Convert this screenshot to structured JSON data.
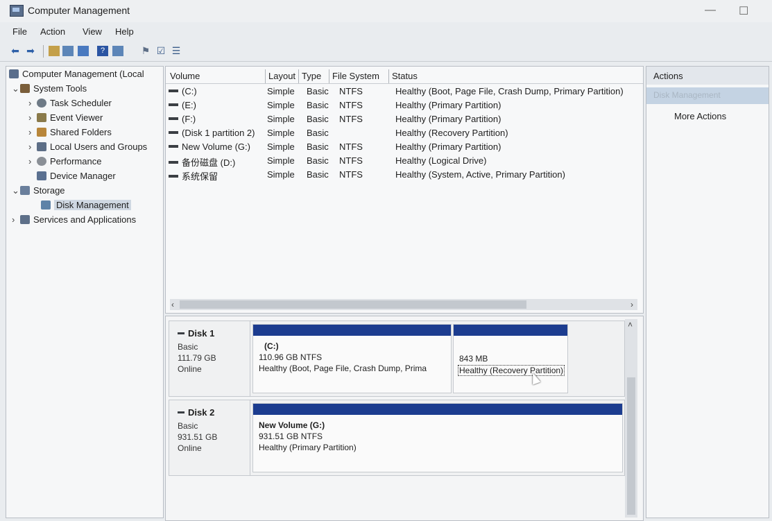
{
  "window": {
    "title": "Computer Management"
  },
  "menu": [
    "File",
    "Action",
    "View",
    "Help"
  ],
  "tree": [
    {
      "label": "Computer Management (Local",
      "chev": "",
      "icon": "computer-management-icon",
      "color": "#5a6e8c"
    },
    {
      "label": "System Tools",
      "chev": "⌄",
      "icon": "system-tools-icon",
      "color": "#7a5e3a"
    },
    {
      "label": "Task Scheduler",
      "chev": "›",
      "icon": "clock-icon",
      "color": "#6e7a86"
    },
    {
      "label": "Event Viewer",
      "chev": "›",
      "icon": "event-viewer-icon",
      "color": "#8a7a4a"
    },
    {
      "label": "Shared Folders",
      "chev": "›",
      "icon": "folder-icon",
      "color": "#b8863a"
    },
    {
      "label": "Local Users and Groups",
      "chev": "›",
      "icon": "users-icon",
      "color": "#5d6e86"
    },
    {
      "label": "Performance",
      "chev": "›",
      "icon": "performance-icon",
      "color": "#8a8f96"
    },
    {
      "label": "Device Manager",
      "chev": "",
      "icon": "device-manager-icon",
      "color": "#5a7090"
    },
    {
      "label": "Storage",
      "chev": "⌄",
      "icon": "storage-icon",
      "color": "#6a7f9c"
    },
    {
      "label": "Disk Management",
      "chev": "",
      "icon": "disk-management-icon",
      "color": "#5e83a8"
    },
    {
      "label": "Services and Applications",
      "chev": "›",
      "icon": "services-icon",
      "color": "#5e7089"
    }
  ],
  "volumes": {
    "headers": [
      "Volume",
      "Layout",
      "Type",
      "File System",
      "Status"
    ],
    "rows": [
      [
        "(C:)",
        "Simple",
        "Basic",
        "NTFS",
        "Healthy (Boot, Page File, Crash Dump, Primary Partition)"
      ],
      [
        "(E:)",
        "Simple",
        "Basic",
        "NTFS",
        "Healthy (Primary Partition)"
      ],
      [
        "(F:)",
        "Simple",
        "Basic",
        "NTFS",
        "Healthy (Primary Partition)"
      ],
      [
        "(Disk 1 partition 2)",
        "Simple",
        "Basic",
        "",
        "Healthy (Recovery Partition)"
      ],
      [
        "New Volume (G:)",
        "Simple",
        "Basic",
        "NTFS",
        "Healthy (Primary Partition)"
      ],
      [
        "备份磁盘 (D:)",
        "Simple",
        "Basic",
        "NTFS",
        "Healthy (Logical Drive)"
      ],
      [
        "系统保留",
        "Simple",
        "Basic",
        "NTFS",
        "Healthy (System, Active, Primary Partition)"
      ]
    ]
  },
  "disks": [
    {
      "name": "Disk 1",
      "type": "Basic",
      "size": "111.79 GB",
      "status": "Online",
      "partitions": [
        {
          "title": "(C:)",
          "size": "110.96 GB NTFS",
          "status": "Healthy (Boot, Page File, Crash Dump, Prima"
        },
        {
          "title": "",
          "size": "843 MB",
          "status": "Healthy (Recovery Partition)"
        }
      ]
    },
    {
      "name": "Disk 2",
      "type": "Basic",
      "size": "931.51 GB",
      "status": "Online",
      "partitions": [
        {
          "title": "New Volume (G:)",
          "size": "931.51 GB NTFS",
          "status": "Healthy (Primary Partition)"
        }
      ]
    }
  ],
  "actions": {
    "title": "Actions",
    "section": "Disk Management",
    "more": "More Actions"
  }
}
